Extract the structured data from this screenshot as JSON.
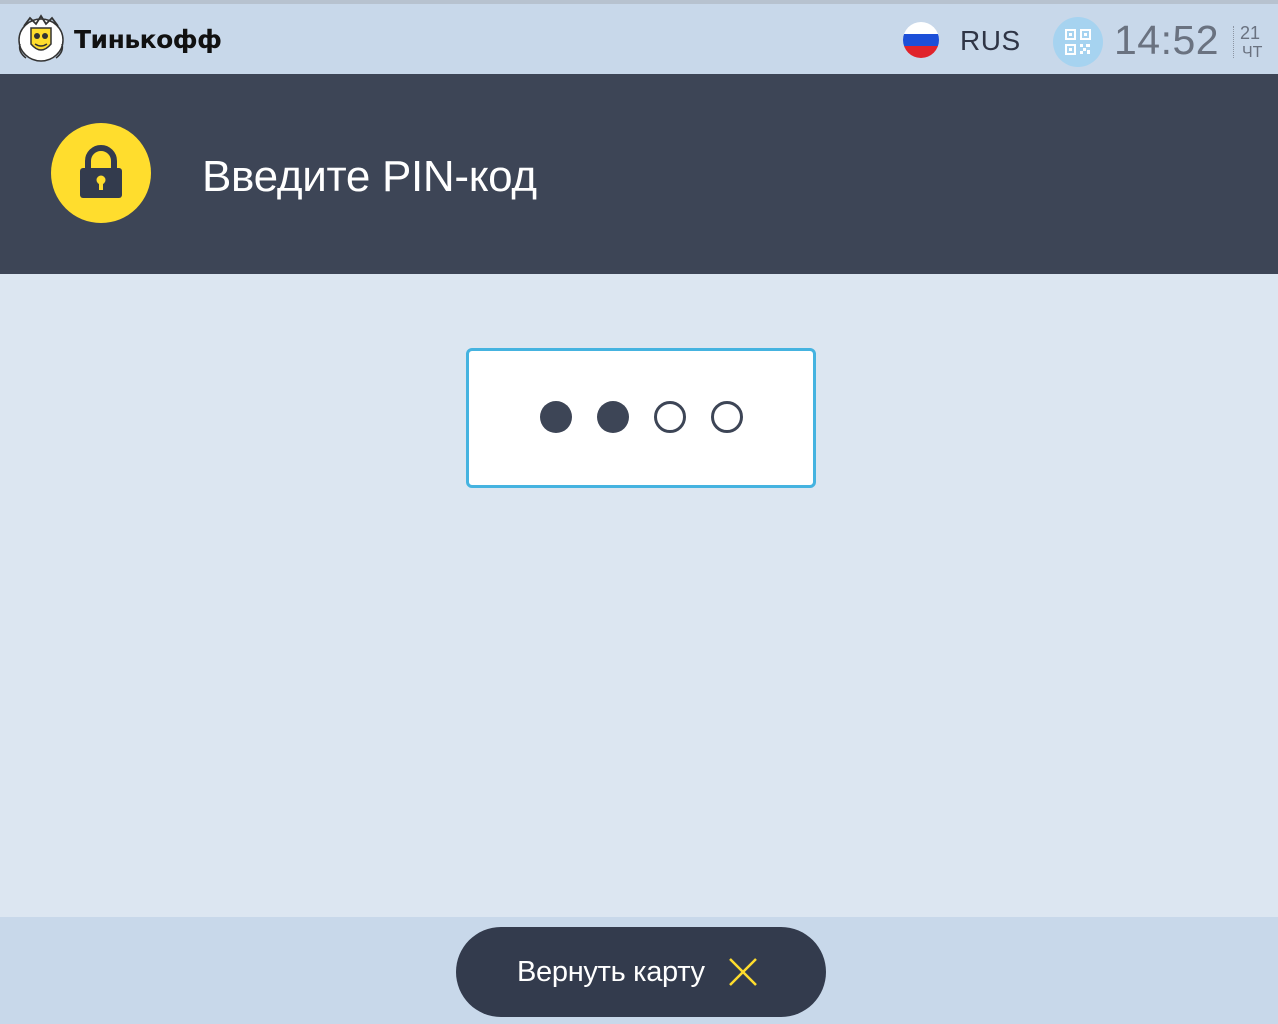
{
  "topbar": {
    "brand_name": "Тинькофф",
    "logo_icon": "tinkoff-coat-of-arms-logo",
    "flag_icon": "russia-flag-icon",
    "language": "RUS",
    "qr_icon": "qr-code-icon",
    "time": "14:52",
    "date_day": "21",
    "date_weekday": "ЧТ"
  },
  "header": {
    "lock_icon": "lock-icon",
    "prompt": "Введите PIN-код"
  },
  "pin": {
    "length": 4,
    "entered": 2
  },
  "footer": {
    "return_card_label": "Вернуть карту",
    "close_icon": "close-icon"
  },
  "colors": {
    "accent_yellow": "#ffdd2d",
    "header_dark": "#3d4556",
    "pin_border": "#45b3e0",
    "background": "#dce6f1",
    "topbar": "#c8d8ea"
  }
}
